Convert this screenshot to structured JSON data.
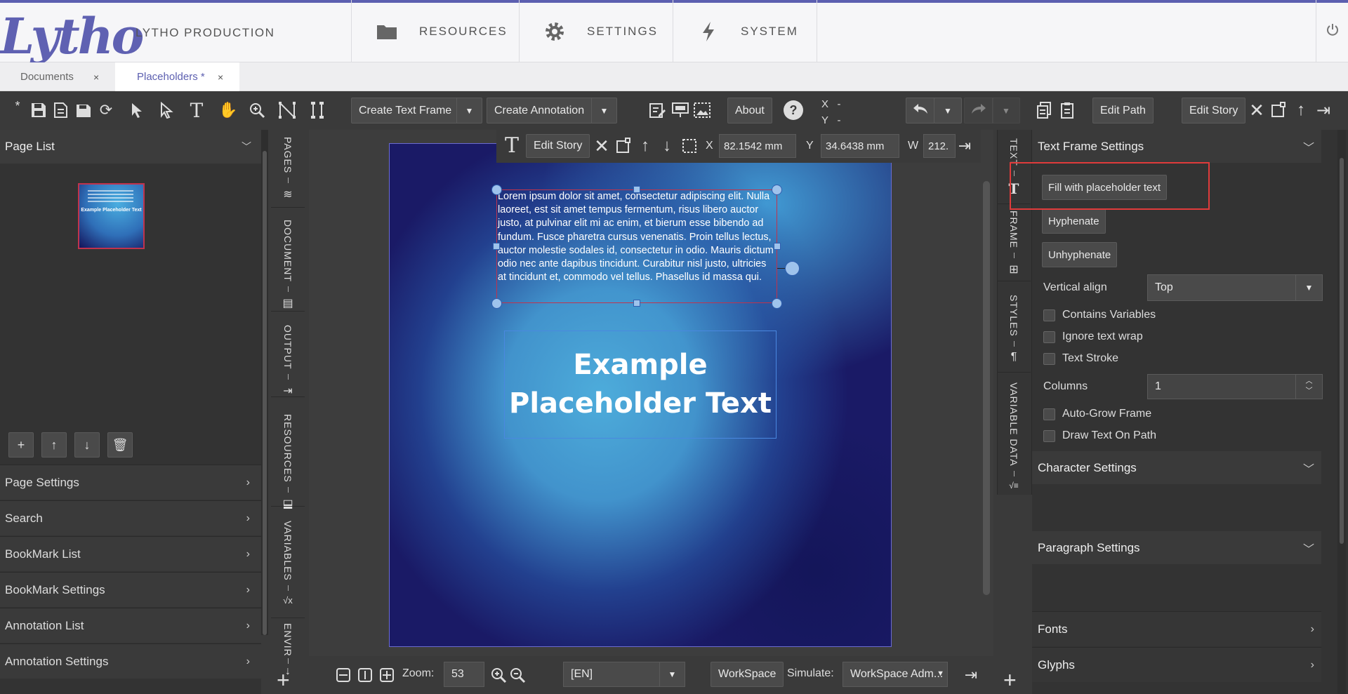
{
  "header": {
    "logo": "Lytho",
    "product": "LYTHO PRODUCTION",
    "nav": [
      {
        "label": "RESOURCES",
        "icon": "folder-icon"
      },
      {
        "label": "SETTINGS",
        "icon": "gear-icon"
      },
      {
        "label": "SYSTEM",
        "icon": "lightning-icon"
      }
    ],
    "power_icon": "power-icon"
  },
  "doc_tabs": [
    {
      "label": "Documents",
      "close": "×",
      "active": false
    },
    {
      "label": "Placeholders *",
      "close": "×",
      "active": true
    }
  ],
  "toolbar": {
    "star": "*",
    "create_text_frame": "Create Text Frame",
    "create_annotation": "Create Annotation",
    "about": "About",
    "help": "?",
    "x_label": "X",
    "x_value": "-",
    "y_label": "Y",
    "y_value": "-",
    "edit_path": "Edit Path",
    "edit_story": "Edit Story"
  },
  "left_panel": {
    "page_list_title": "Page List",
    "thumbnail_text": "Example Placeholder Text",
    "accordions": [
      "Page Settings",
      "Search",
      "BookMark List",
      "BookMark Settings",
      "Annotation List",
      "Annotation Settings"
    ]
  },
  "left_vtabs": [
    {
      "label": "PAGES",
      "icon": "layers-icon",
      "glyph": "≋"
    },
    {
      "label": "DOCUMENT",
      "icon": "document-icon",
      "glyph": "▤"
    },
    {
      "label": "OUTPUT",
      "icon": "output-icon",
      "glyph": "⇥"
    },
    {
      "label": "RESOURCES",
      "icon": "stamp-icon",
      "glyph": "⬓"
    },
    {
      "label": "VARIABLES",
      "icon": "sqrt-icon",
      "glyph": "√x"
    },
    {
      "label": "ENVIR",
      "icon": "arrow-down-icon",
      "glyph": "↓"
    }
  ],
  "context_bar": {
    "edit_story": "Edit Story",
    "x_label": "X",
    "x_value": "82.1542 mm",
    "y_label": "Y",
    "y_value": "34.6438 mm",
    "w_label": "W",
    "w_value": "212."
  },
  "canvas": {
    "lorem": "Lorem ipsum dolor sit amet, consectetur adipiscing elit. Nulla laoreet, est sit amet tempus fermentum, risus libero auctor justo, at pulvinar elit mi ac enim, et bierum esse bibendo ad fundum. Fusce pharetra cursus venenatis. Proin tellus lectus, auctor molestie sodales id, consectetur in odio. Mauris dictum odio nec ante dapibus tincidunt. Curabitur nisl justo, ultricies at tincidunt et, commodo vel tellus. Phasellus id massa qui.",
    "placeholder": "Example Placeholder Text"
  },
  "bottom_bar": {
    "zoom_label": "Zoom:",
    "zoom_value": "53",
    "language": "[EN]",
    "workspace": "WorkSpace",
    "simulate_label": "Simulate:",
    "simulate_value": "WorkSpace Adm..."
  },
  "right_vtabs": [
    {
      "label": "TEXT",
      "icon": "text-icon",
      "glyph": "T"
    },
    {
      "label": "FRAME",
      "icon": "grid-icon",
      "glyph": "⊞"
    },
    {
      "label": "STYLES",
      "icon": "pilcrow-icon",
      "glyph": "¶"
    },
    {
      "label": "VARIABLE DATA",
      "icon": "sqrt-icon",
      "glyph": "√≡"
    }
  ],
  "right_panel": {
    "text_frame_settings": "Text Frame Settings",
    "fill_placeholder": "Fill with placeholder text",
    "hyphenate": "Hyphenate",
    "unhyphenate": "Unhyphenate",
    "vertical_align_label": "Vertical align",
    "vertical_align_value": "Top",
    "contains_variables": "Contains Variables",
    "ignore_text_wrap": "Ignore text wrap",
    "text_stroke": "Text Stroke",
    "columns_label": "Columns",
    "columns_value": "1",
    "auto_grow_frame": "Auto-Grow Frame",
    "draw_text_on_path": "Draw Text On Path",
    "character_settings": "Character Settings",
    "paragraph_settings": "Paragraph Settings",
    "fonts": "Fonts",
    "glyphs": "Glyphs"
  },
  "colors": {
    "brand": "#5f61b2",
    "highlight": "#e03b3b",
    "selection": "#c0334d"
  }
}
